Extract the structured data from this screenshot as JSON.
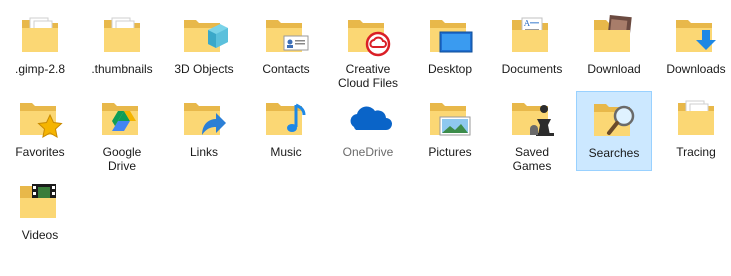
{
  "items": [
    {
      "label": ".gimp-2.8",
      "icon": "folder-papers-icon"
    },
    {
      "label": ".thumbnails",
      "icon": "folder-papers-icon"
    },
    {
      "label": "3D Objects",
      "icon": "folder-3d-objects-icon"
    },
    {
      "label": "Contacts",
      "icon": "folder-contacts-icon"
    },
    {
      "label": "Creative\nCloud Files",
      "icon": "folder-creative-cloud-icon"
    },
    {
      "label": "Desktop",
      "icon": "folder-desktop-icon"
    },
    {
      "label": "Documents",
      "icon": "folder-documents-icon"
    },
    {
      "label": "Download",
      "icon": "folder-download-photo-icon"
    },
    {
      "label": "Downloads",
      "icon": "folder-downloads-arrow-icon"
    },
    {
      "label": "Favorites",
      "icon": "folder-favorites-star-icon"
    },
    {
      "label": "Google\nDrive",
      "icon": "folder-google-drive-icon"
    },
    {
      "label": "Links",
      "icon": "folder-links-arrow-icon"
    },
    {
      "label": "Music",
      "icon": "folder-music-note-icon"
    },
    {
      "label": "OneDrive",
      "icon": "onedrive-cloud-icon"
    },
    {
      "label": "Pictures",
      "icon": "folder-pictures-icon"
    },
    {
      "label": "Saved\nGames",
      "icon": "folder-saved-games-chess-icon"
    },
    {
      "label": "Searches",
      "icon": "folder-searches-magnifier-icon",
      "selected": true
    },
    {
      "label": "Tracing",
      "icon": "folder-papers-icon"
    },
    {
      "label": "Videos",
      "icon": "folder-videos-filmstrip-icon"
    }
  ],
  "colors": {
    "folder_back": "#e8b84a",
    "folder_front": "#fbd774",
    "selection_bg": "#cce8ff",
    "selection_border": "#99d1ff"
  }
}
